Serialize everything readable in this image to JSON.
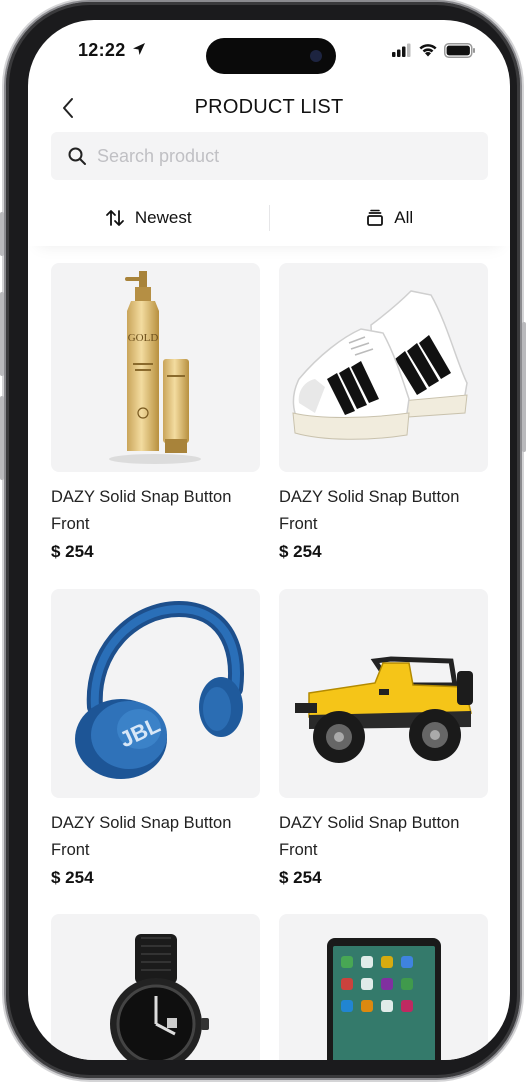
{
  "status": {
    "time": "12:22"
  },
  "header": {
    "title": "PRODUCT LIST"
  },
  "search": {
    "placeholder": "Search product"
  },
  "filters": [
    {
      "label": "Newest",
      "icon": "sort-arrows-icon"
    },
    {
      "label": "All",
      "icon": "layers-icon"
    }
  ],
  "products": [
    {
      "name": "DAZY Solid Snap Button Front",
      "price": "$ 254",
      "image": "cosmetic-bottles-image",
      "bottle_text": "GOLD"
    },
    {
      "name": "DAZY Solid Snap Button Front",
      "price": "$ 254",
      "image": "sneakers-image"
    },
    {
      "name": "DAZY Solid Snap Button Front",
      "price": "$ 254",
      "image": "headphones-image",
      "brand_text": "JBL"
    },
    {
      "name": "DAZY Solid Snap Button Front",
      "price": "$ 254",
      "image": "toy-jeep-image"
    },
    {
      "name": "",
      "price": "",
      "image": "wristwatch-image"
    },
    {
      "name": "",
      "price": "",
      "image": "tablet-image"
    }
  ],
  "colors": {
    "accent": "#111111",
    "card_bg": "#f3f3f4",
    "search_bg": "#f4f4f5",
    "placeholder": "#c0c0c4"
  }
}
